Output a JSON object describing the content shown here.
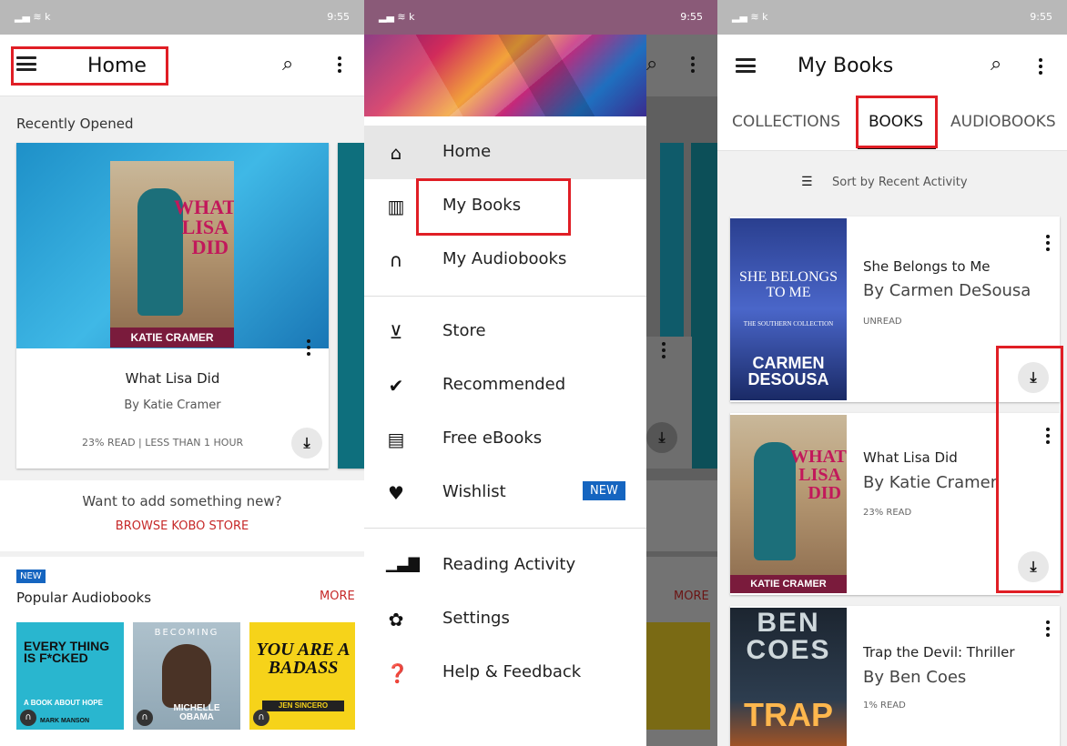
{
  "status": {
    "time": "9:55"
  },
  "screen1": {
    "title": "Home",
    "recently_opened": "Recently Opened",
    "book": {
      "cover_title": "WHAT LISA DID",
      "cover_author": "KATIE CRAMER",
      "title": "What Lisa Did",
      "author": "By Katie Cramer",
      "progress": "23% READ | LESS THAN 1 HOUR"
    },
    "promo_text": "Want to add something new?",
    "promo_link": "BROWSE KOBO STORE",
    "new_badge": "NEW",
    "popular_title": "Popular Audiobooks",
    "more": "MORE",
    "audiobooks": [
      {
        "cover": "EVERY THING IS F*CKED",
        "sub": "A BOOK ABOUT HOPE",
        "author": "MARK MANSON"
      },
      {
        "cover": "BECOMING",
        "author": "MICHELLE OBAMA"
      },
      {
        "cover": "YOU ARE A BADASS",
        "author": "JEN SINCERO"
      }
    ]
  },
  "screen2": {
    "menu": [
      {
        "label": "Home",
        "icon": "home-icon"
      },
      {
        "label": "My Books",
        "icon": "library-icon"
      },
      {
        "label": "My Audiobooks",
        "icon": "headphones-icon"
      },
      {
        "label": "Store",
        "icon": "cart-icon"
      },
      {
        "label": "Recommended",
        "icon": "check-badge-icon"
      },
      {
        "label": "Free eBooks",
        "icon": "open-book-icon"
      },
      {
        "label": "Wishlist",
        "icon": "heart-icon"
      },
      {
        "label": "Reading Activity",
        "icon": "bar-chart-icon"
      },
      {
        "label": "Settings",
        "icon": "gear-icon"
      },
      {
        "label": "Help & Feedback",
        "icon": "help-icon"
      }
    ],
    "wishlist_badge": "NEW",
    "more": "MORE"
  },
  "screen3": {
    "title": "My Books",
    "tabs": [
      "COLLECTIONS",
      "BOOKS",
      "AUDIOBOOKS"
    ],
    "sort": "Sort by Recent Activity",
    "books": [
      {
        "title": "She Belongs to Me",
        "author": "By Carmen DeSousa",
        "status": "UNREAD",
        "cover_title": "SHE BELONGS TO ME",
        "cover_sub": "THE SOUTHERN COLLECTION",
        "cover_author": "CARMEN DESOUSA"
      },
      {
        "title": "What Lisa Did",
        "author": "By Katie Cramer",
        "status": "23% READ",
        "cover_title": "WHAT LISA DID",
        "cover_author": "KATIE CRAMER"
      },
      {
        "title": "Trap the Devil: Thriller",
        "author": "By Ben Coes",
        "status": "1% READ",
        "cover_title": "TRAP",
        "cover_author": "BEN COES"
      }
    ]
  },
  "colors": {
    "highlight": "#e01e25",
    "link": "#c62828",
    "badge": "#1565c0"
  }
}
